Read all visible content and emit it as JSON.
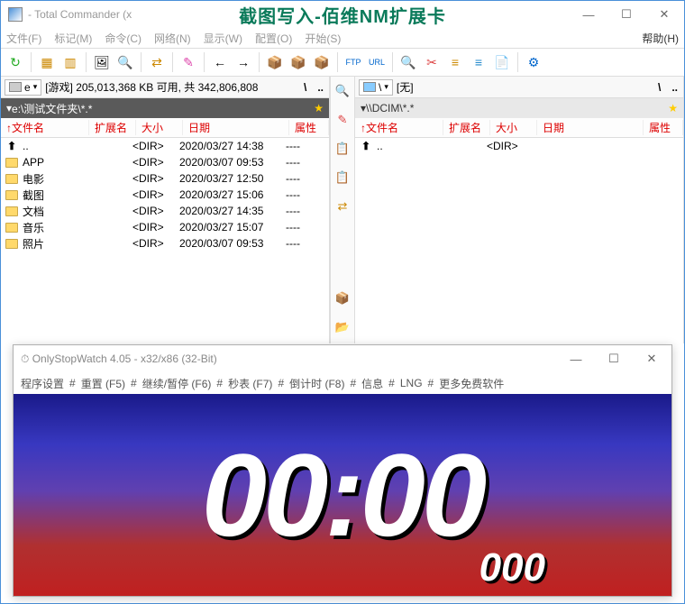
{
  "tc": {
    "title": " - Total Commander (x",
    "overlay": "截图写入-佰维NM扩展卡",
    "menu": [
      "文件(F)",
      "标记(M)",
      "命令(C)",
      "网络(N)",
      "显示(W)",
      "配置(O)",
      "开始(S)"
    ],
    "help": "帮助(H)",
    "toolbar_icons": [
      "↻",
      "▦",
      "▥",
      "🖼",
      "🔍",
      "⇄",
      "✎",
      "←",
      "→",
      "📦",
      "📦",
      "📦",
      "FTP",
      "URL",
      "🔍",
      "✂",
      "≡",
      "≡",
      "📄",
      "⚙"
    ],
    "mid_icons": [
      "🔍",
      "✎",
      "📋",
      "📋",
      "⇄",
      "📦",
      "📂"
    ],
    "left": {
      "drive": "e",
      "drive_info": "[游戏] 205,013,368 KB 可用, 共 342,806,808",
      "path": "e:\\测试文件夹\\*.*",
      "cols": {
        "name": "文件名",
        "ext": "扩展名",
        "size": "大小",
        "date": "日期",
        "attr": "属性"
      },
      "rows": [
        {
          "icon": "up",
          "name": "..",
          "ext": "",
          "size": "<DIR>",
          "date": "2020/03/27 14:38",
          "attr": "----"
        },
        {
          "icon": "folder",
          "name": "APP",
          "ext": "",
          "size": "<DIR>",
          "date": "2020/03/07 09:53",
          "attr": "----"
        },
        {
          "icon": "folder",
          "name": "电影",
          "ext": "",
          "size": "<DIR>",
          "date": "2020/03/27 12:50",
          "attr": "----"
        },
        {
          "icon": "folder",
          "name": "截图",
          "ext": "",
          "size": "<DIR>",
          "date": "2020/03/27 15:06",
          "attr": "----"
        },
        {
          "icon": "folder",
          "name": "文档",
          "ext": "",
          "size": "<DIR>",
          "date": "2020/03/27 14:35",
          "attr": "----"
        },
        {
          "icon": "folder",
          "name": "音乐",
          "ext": "",
          "size": "<DIR>",
          "date": "2020/03/27 15:07",
          "attr": "----"
        },
        {
          "icon": "folder",
          "name": "照片",
          "ext": "",
          "size": "<DIR>",
          "date": "2020/03/07 09:53",
          "attr": "----"
        }
      ]
    },
    "right": {
      "drive": "\\",
      "drive_info": "[无]",
      "path": "\\\\DCIM\\*.*",
      "cols": {
        "name": "文件名",
        "ext": "扩展名",
        "size": "大小",
        "date": "日期",
        "attr": "属性"
      },
      "rows": [
        {
          "icon": "up",
          "name": "..",
          "ext": "",
          "size": "<DIR>",
          "date": "",
          "attr": ""
        }
      ]
    },
    "nav_back": "\\",
    "nav_up": ".."
  },
  "osw": {
    "title": "OnlyStopWatch 4.05 - x32/x86 (32-Bit)",
    "menu": [
      "程序设置",
      "#",
      "重置 (F5)",
      "#",
      "继续/暂停 (F6)",
      "#",
      "秒表 (F7)",
      "#",
      "倒计时 (F8)",
      "#",
      "信息",
      "#",
      "LNG",
      "#",
      "更多免费软件"
    ],
    "time": "00:00",
    "ms": "000"
  }
}
